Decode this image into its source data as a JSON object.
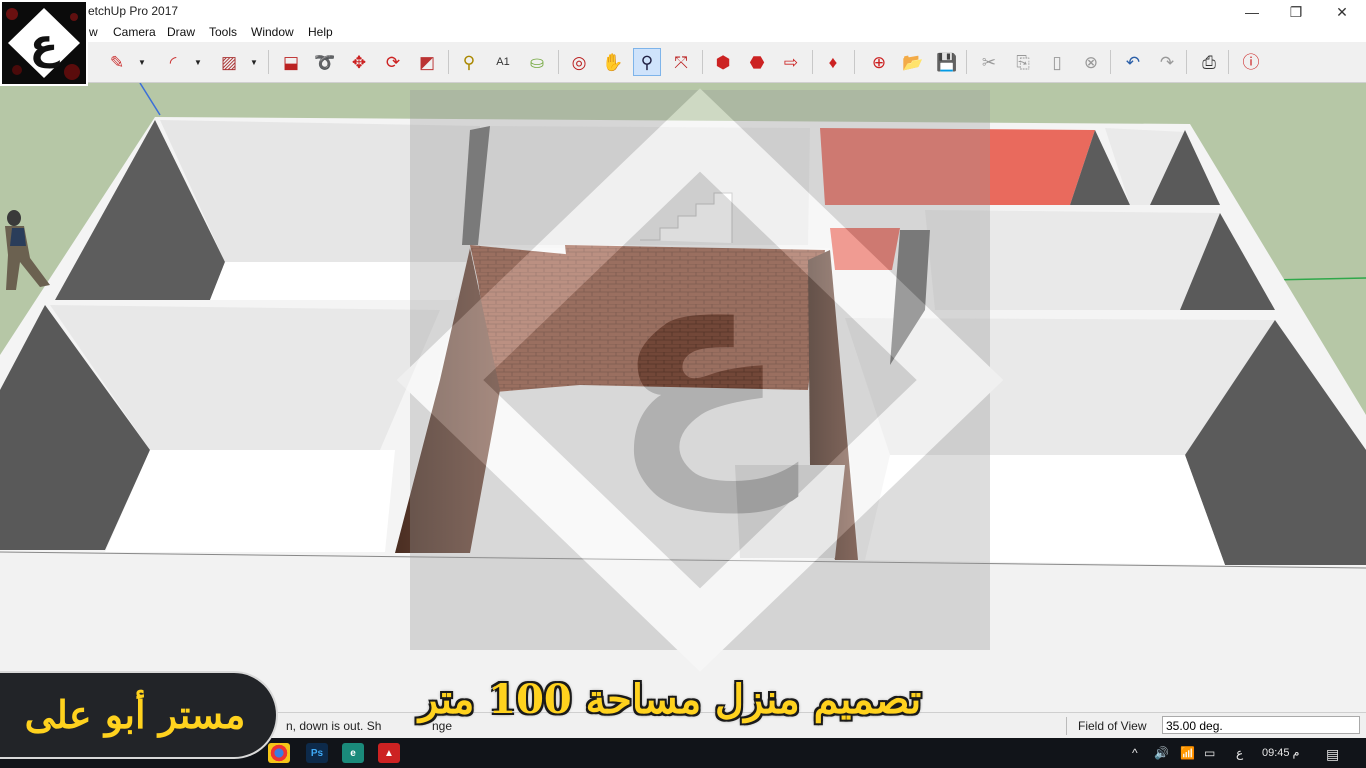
{
  "app": {
    "title": "etchUp Pro 2017",
    "window_controls": [
      "—",
      "❐",
      "✕"
    ]
  },
  "menu": {
    "items": [
      "w",
      "Camera",
      "Draw",
      "Tools",
      "Window",
      "Help"
    ]
  },
  "toolbar": {
    "tools": [
      "pencil-icon",
      "arc-icon",
      "rectangle-icon",
      "pushpull-icon",
      "followme-icon",
      "move-icon",
      "rotate-icon",
      "scale-icon",
      "tape-icon",
      "text-icon",
      "paint-icon",
      "orbit-icon",
      "pan-icon",
      "zoom-icon",
      "zoom-extents-icon",
      "warehouse-icon",
      "share-model-icon",
      "send-layout-icon",
      "extension-icon",
      "add-location-icon",
      "open-icon",
      "save-icon",
      "cut-icon",
      "copy-icon",
      "paste-icon",
      "erase-icon",
      "undo-icon",
      "redo-icon",
      "print-icon",
      "model-info-icon"
    ],
    "active_tool": "zoom-icon"
  },
  "logo": {
    "glyph": "ع"
  },
  "viewport": {
    "background_color": "#b6c7a6",
    "watermark_glyph": "ع"
  },
  "statusbar": {
    "hint": "n, down is out. Sh",
    "hint_tail": "nge",
    "fov_label": "Field of View",
    "fov_value": "35.00 deg."
  },
  "taskbar": {
    "apps": [
      "chrome-icon",
      "photoshop-icon",
      "browser-icon",
      "sketchup-icon"
    ],
    "tray": {
      "chevron": "^",
      "volume": "🔊",
      "network": "📶",
      "battery": "▭",
      "language": "ع",
      "time": "09:45 م"
    }
  },
  "overlay": {
    "channel_name": "مستر أبو على",
    "video_title": "تصميم منزل مساحة 100 متر"
  }
}
